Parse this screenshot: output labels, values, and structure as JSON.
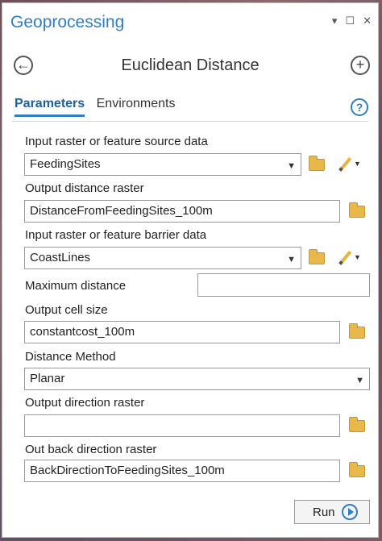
{
  "window": {
    "title": "Geoprocessing",
    "pin_glyph": "▾",
    "maximize_glyph": "☐",
    "close_glyph": "✕"
  },
  "tool": {
    "title": "Euclidean Distance",
    "back_glyph": "←",
    "add_glyph": "+"
  },
  "tabs": [
    {
      "label": "Parameters",
      "active": true
    },
    {
      "label": "Environments",
      "active": false
    }
  ],
  "help_glyph": "?",
  "params": {
    "input_source": {
      "label": "Input raster or feature source data",
      "value": "FeedingSites"
    },
    "output_distance": {
      "label": "Output distance raster",
      "value": "DistanceFromFeedingSites_100m"
    },
    "input_barrier": {
      "label": "Input raster or feature barrier data",
      "value": "CoastLines"
    },
    "max_distance": {
      "label": "Maximum distance",
      "value": ""
    },
    "cell_size": {
      "label": "Output cell size",
      "value": "constantcost_100m"
    },
    "distance_method": {
      "label": "Distance Method",
      "value": "Planar"
    },
    "output_direction": {
      "label": "Output direction raster",
      "value": ""
    },
    "back_direction": {
      "label": "Out back direction raster",
      "value": "BackDirectionToFeedingSites_100m"
    }
  },
  "dropdown_arrow": "▼",
  "run": {
    "label": "Run"
  },
  "colors": {
    "accent": "#2e7fc3",
    "folder": "#e8b84a"
  }
}
